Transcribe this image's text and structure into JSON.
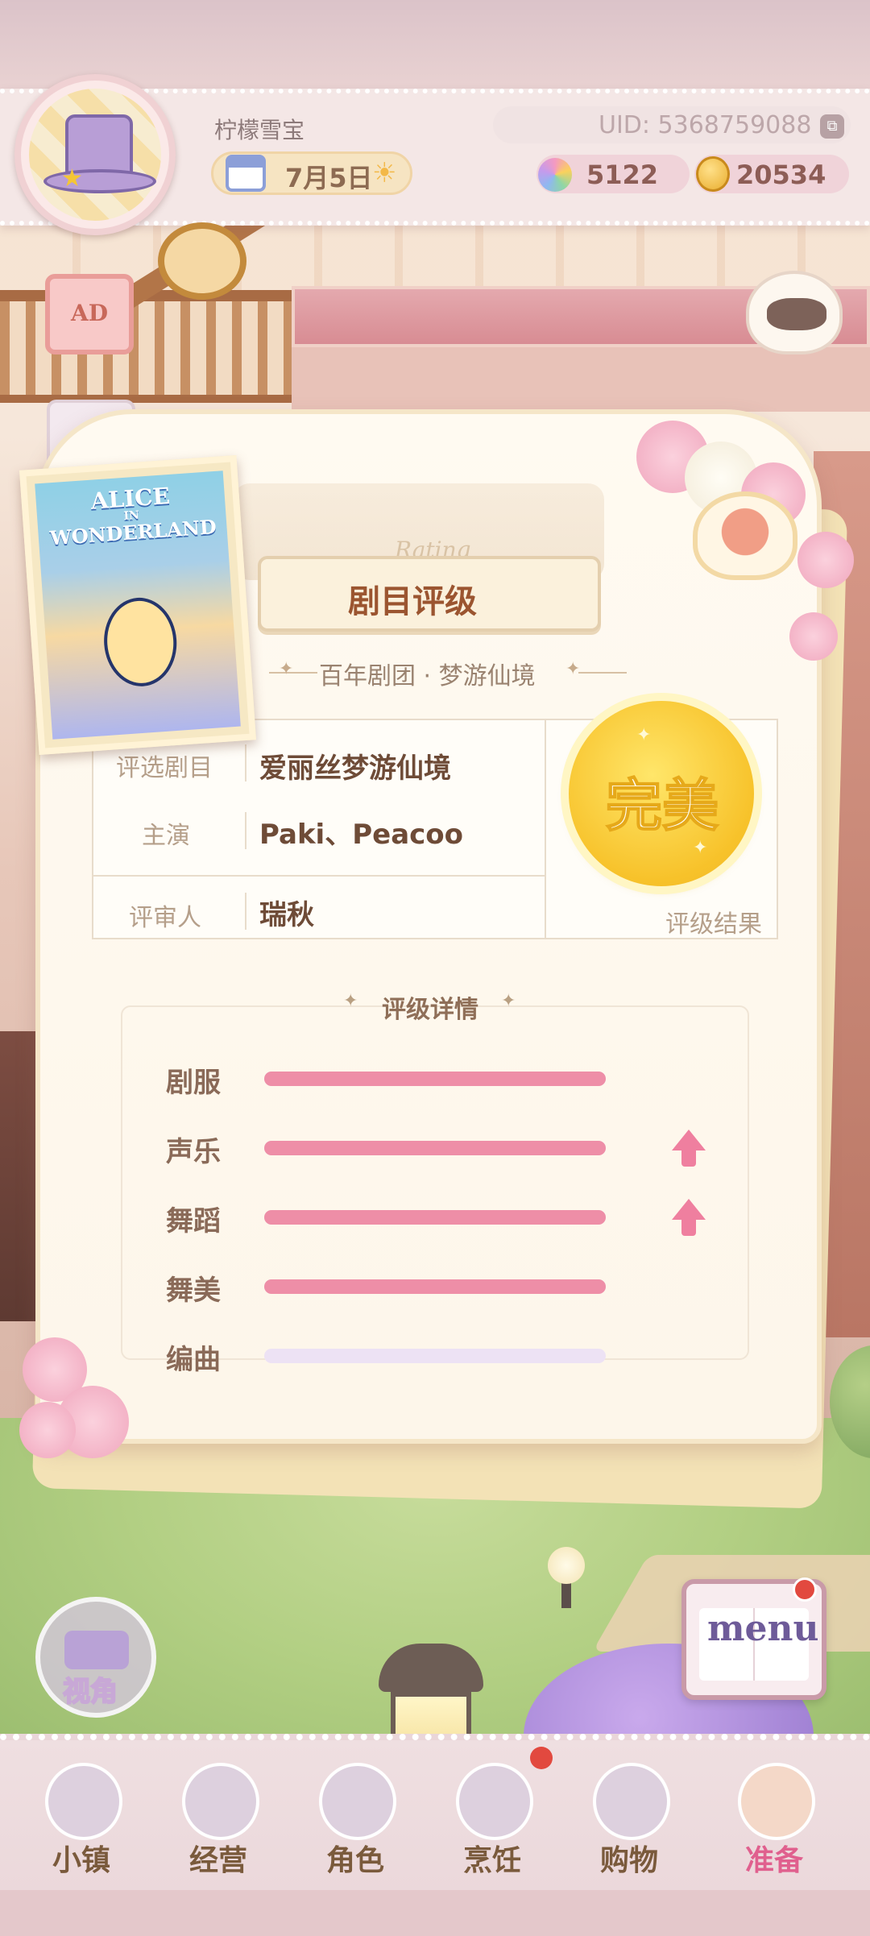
{
  "header": {
    "username": "柠檬雪宝",
    "uid": "UID: 5368759088",
    "date": "7月5日",
    "gems": "5122",
    "coins": "20534"
  },
  "side": {
    "ad_label": "AD",
    "camera_label": "视角",
    "menu_label": "menu"
  },
  "poster": {
    "line1": "ALICE",
    "line2": "IN",
    "line3": "WONDERLAND"
  },
  "panel": {
    "watermark": "Rating",
    "title": "剧目评级",
    "subtitle": "百年剧团 · 梦游仙境",
    "rows": [
      {
        "label": "评选剧目",
        "value": "爱丽丝梦游仙境"
      },
      {
        "label": "主演",
        "value": "Paki、Peacoo"
      },
      {
        "label": "评审人",
        "value": "瑞秋"
      }
    ],
    "result": {
      "badge": "完美",
      "label": "评级结果"
    },
    "details_title": "评级详情",
    "stats": [
      {
        "label": "剧服",
        "fill": 1.0,
        "up": false
      },
      {
        "label": "声乐",
        "fill": 1.0,
        "up": true
      },
      {
        "label": "舞蹈",
        "fill": 1.0,
        "up": true
      },
      {
        "label": "舞美",
        "fill": 1.0,
        "up": false
      },
      {
        "label": "编曲",
        "fill": 0.0,
        "up": false
      }
    ]
  },
  "nav": {
    "items": [
      {
        "label": "小镇",
        "icon": "map-icon",
        "active": false
      },
      {
        "label": "经营",
        "icon": "shopping-bag-icon",
        "active": false
      },
      {
        "label": "角色",
        "icon": "character-icon",
        "active": false
      },
      {
        "label": "烹饪",
        "icon": "sandwich-icon",
        "active": false
      },
      {
        "label": "购物",
        "icon": "gift-bag-icon",
        "active": false
      },
      {
        "label": "准备",
        "icon": "basket-icon",
        "active": true
      }
    ]
  },
  "colors": {
    "accent_pink": "#ee8ea7",
    "empty_track": "#ede2f4",
    "badge_gold": "#f7c22a",
    "active_nav": "#e0608e"
  }
}
